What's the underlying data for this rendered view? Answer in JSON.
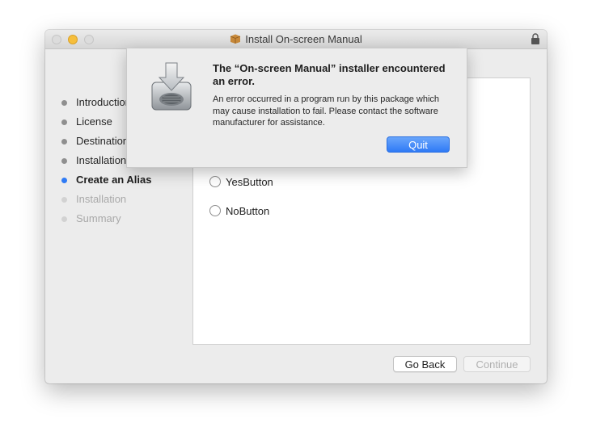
{
  "window": {
    "title": "Install On-screen Manual"
  },
  "sidebar": {
    "steps": [
      {
        "label": "Introduction",
        "state": "done"
      },
      {
        "label": "License",
        "state": "done"
      },
      {
        "label": "Destination",
        "state": "done"
      },
      {
        "label": "Installation",
        "state": "done"
      },
      {
        "label": "Create an Alias",
        "state": "current"
      },
      {
        "label": "Installation",
        "state": "pending"
      },
      {
        "label": "Summary",
        "state": "pending"
      }
    ]
  },
  "content": {
    "options": [
      {
        "label": "YesButton",
        "selected": false
      },
      {
        "label": "NoButton",
        "selected": false
      }
    ]
  },
  "buttons": {
    "go_back": "Go Back",
    "continue": "Continue"
  },
  "alert": {
    "title": "The “On-screen Manual” installer encountered an error.",
    "message": "An error occurred in a program run by this package which may cause installation to fail. Please contact the software manufacturer for assistance.",
    "quit": "Quit",
    "icon": "installer-drive-icon"
  },
  "colors": {
    "accent": "#2f7bf5",
    "minimize": "#f6be3b"
  }
}
